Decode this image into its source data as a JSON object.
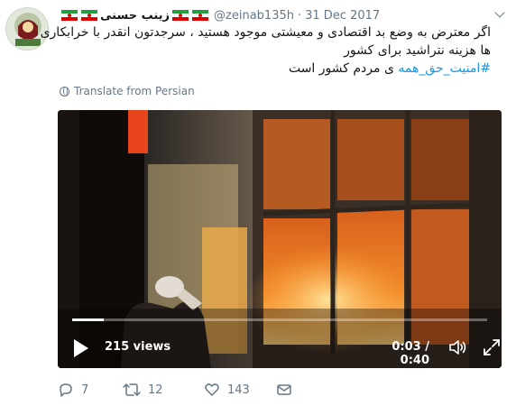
{
  "tweet": {
    "display_name": "زینب حسنی",
    "handle": "@zeinab135h",
    "separator": "·",
    "date": "31 Dec 2017",
    "text_lines": [
      "اگر معترض به وضع بد اقتصادی و معیشتی موجود هستید ، سرجدتون انقدر با خرابکاری",
      "ها هزینه نتراشید برای کشور"
    ],
    "hashtag": "#امنیت_حق_همه",
    "text_after_hashtag": "ی مردم کشور است",
    "translate_label": "Translate from Persian"
  },
  "video": {
    "views": "215 views",
    "time": "0:03 / 0:40",
    "progress": 0.075
  },
  "actions": {
    "replies": "7",
    "retweets": "12",
    "likes": "143"
  },
  "colors": {
    "link": "#1b95e0",
    "secondary": "#657786",
    "flag_green": "#239f40",
    "flag_red": "#da0000"
  },
  "icons": [
    "avatar",
    "iran-flag-icon",
    "chevron-down-icon",
    "globe-icon",
    "play-icon",
    "volume-icon",
    "fullscreen-icon",
    "reply-icon",
    "retweet-icon",
    "like-icon",
    "message-icon"
  ]
}
